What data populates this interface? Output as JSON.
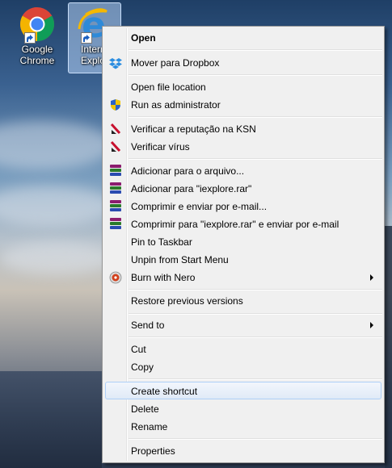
{
  "desktop": {
    "icons": [
      {
        "label_line1": "Google",
        "label_line2": "Chrome",
        "icon": "chrome-icon"
      },
      {
        "label_line1": "Interr",
        "label_line2": "Explo",
        "icon": "internet-explorer-icon"
      }
    ]
  },
  "context_menu": {
    "items": [
      {
        "label": "Open",
        "bold": true
      },
      {
        "label": "Mover para Dropbox",
        "icon": "dropbox-icon"
      },
      {
        "label": "Open file location"
      },
      {
        "label": "Run as administrator",
        "icon": "uac-shield-icon"
      },
      {
        "label": "Verificar a reputação na KSN",
        "icon": "kaspersky-icon"
      },
      {
        "label": "Verificar vírus",
        "icon": "kaspersky-icon"
      },
      {
        "label": "Adicionar para o arquivo...",
        "icon": "winrar-icon"
      },
      {
        "label": "Adicionar para \"iexplore.rar\"",
        "icon": "winrar-icon"
      },
      {
        "label": "Comprimir e enviar por e-mail...",
        "icon": "winrar-icon"
      },
      {
        "label": "Comprimir para \"iexplore.rar\" e enviar por e-mail",
        "icon": "winrar-icon"
      },
      {
        "label": "Pin to Taskbar"
      },
      {
        "label": "Unpin from Start Menu"
      },
      {
        "label": "Burn with Nero",
        "icon": "nero-icon",
        "submenu": true
      },
      {
        "label": "Restore previous versions"
      },
      {
        "label": "Send to",
        "submenu": true
      },
      {
        "label": "Cut"
      },
      {
        "label": "Copy"
      },
      {
        "label": "Create shortcut",
        "highlighted": true
      },
      {
        "label": "Delete"
      },
      {
        "label": "Rename"
      },
      {
        "label": "Properties"
      }
    ]
  },
  "colors": {
    "menu_bg": "#f0f0f0",
    "menu_border": "#979797",
    "highlight_border": "#aecff7"
  }
}
